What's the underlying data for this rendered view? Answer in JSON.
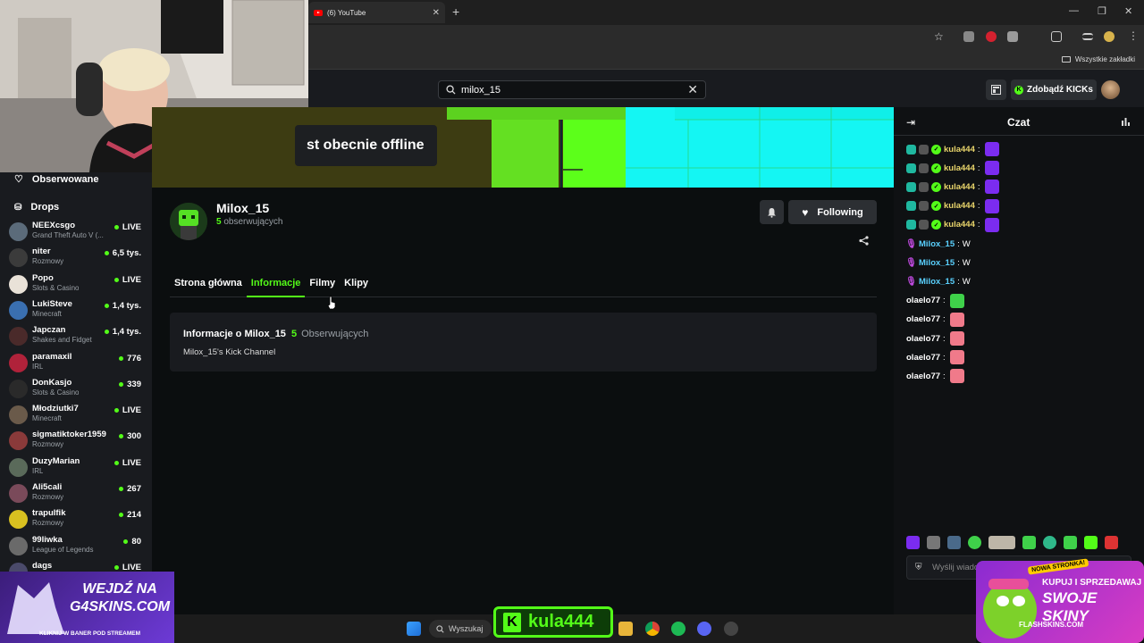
{
  "browser": {
    "tab_title": "(6) YouTube",
    "new_tab": "+",
    "bookmarks_folder": "Wszystkie zakładki"
  },
  "header": {
    "search_value": "milox_15",
    "kicks_button": "Zdobądź KICKs"
  },
  "sidebar": {
    "following": "Obserwowane",
    "drops": "Drops",
    "channels": [
      {
        "name": "NEEXcsgo",
        "category": "Grand Theft Auto V (...",
        "viewers": "LIVE",
        "color": "#5b6b7a"
      },
      {
        "name": "niter",
        "category": "Rozmowy",
        "viewers": "6,5 tys.",
        "color": "#3b3b3b"
      },
      {
        "name": "Popo",
        "category": "Slots & Casino",
        "viewers": "LIVE",
        "color": "#e9e2d8"
      },
      {
        "name": "LukiSteve",
        "category": "Minecraft",
        "viewers": "1,4 tys.",
        "color": "#3a6fb0"
      },
      {
        "name": "Japczan",
        "category": "Shakes and Fidget",
        "viewers": "1,4 tys.",
        "color": "#4a2a2a"
      },
      {
        "name": "paramaxil",
        "category": "IRL",
        "viewers": "776",
        "color": "#b0223a"
      },
      {
        "name": "DonKasjo",
        "category": "Slots & Casino",
        "viewers": "339",
        "color": "#2a2a2a"
      },
      {
        "name": "Młodziutki7",
        "category": "Minecraft",
        "viewers": "LIVE",
        "color": "#6a5a4a"
      },
      {
        "name": "sigmatiktoker1959",
        "category": "Rozmowy",
        "viewers": "300",
        "color": "#8a3a3a"
      },
      {
        "name": "DuzyMarian",
        "category": "IRL",
        "viewers": "LIVE",
        "color": "#5a6a5a"
      },
      {
        "name": "Ali5cali",
        "category": "Rozmowy",
        "viewers": "267",
        "color": "#7a4a5a"
      },
      {
        "name": "trapulfik",
        "category": "Rozmowy",
        "viewers": "214",
        "color": "#d8c020"
      },
      {
        "name": "99liwka",
        "category": "League of Legends",
        "viewers": "80",
        "color": "#6a6a6a"
      },
      {
        "name": "dags",
        "category": "",
        "viewers": "LIVE",
        "color": "#4a4a6a"
      }
    ]
  },
  "banner": {
    "offline_text": "st obecnie offline"
  },
  "profile": {
    "name": "Milox_15",
    "followers_count": "5",
    "followers_label": "obserwujących",
    "following_button": "Following"
  },
  "tabs": [
    "Strona główna",
    "Informacje",
    "Filmy",
    "Klipy"
  ],
  "about": {
    "title": "Informacje o Milox_15",
    "count": "5",
    "count_label": "Obserwujących",
    "description": "Milox_15's Kick Channel"
  },
  "chat": {
    "title": "Czat",
    "messages": [
      {
        "user": "kula444",
        "text": "",
        "user_color": "#e9d56b",
        "badges": true,
        "emote": "#7b2cf0"
      },
      {
        "user": "kula444",
        "text": "",
        "user_color": "#e9d56b",
        "badges": true,
        "emote": "#7b2cf0"
      },
      {
        "user": "kula444",
        "text": "",
        "user_color": "#e9d56b",
        "badges": true,
        "emote": "#7b2cf0"
      },
      {
        "user": "kula444",
        "text": "",
        "user_color": "#e9d56b",
        "badges": true,
        "emote": "#7b2cf0"
      },
      {
        "user": "kula444",
        "text": "",
        "user_color": "#e9d56b",
        "badges": true,
        "emote": "#7b2cf0"
      },
      {
        "user": "Milox_15",
        "text": "W",
        "user_color": "#5ad1ff",
        "badges": false,
        "emote": ""
      },
      {
        "user": "Milox_15",
        "text": "W",
        "user_color": "#5ad1ff",
        "badges": false,
        "emote": ""
      },
      {
        "user": "Milox_15",
        "text": "W",
        "user_color": "#5ad1ff",
        "badges": false,
        "emote": ""
      },
      {
        "user": "olaelo77",
        "text": "",
        "user_color": "#ffffff",
        "badges": false,
        "emote": "#3fd14a"
      },
      {
        "user": "olaelo77",
        "text": "",
        "user_color": "#ffffff",
        "badges": false,
        "emote": "#f07a8a"
      },
      {
        "user": "olaelo77",
        "text": "",
        "user_color": "#ffffff",
        "badges": false,
        "emote": "#f07a8a"
      },
      {
        "user": "olaelo77",
        "text": "",
        "user_color": "#ffffff",
        "badges": false,
        "emote": "#f07a8a"
      },
      {
        "user": "olaelo77",
        "text": "",
        "user_color": "#ffffff",
        "badges": false,
        "emote": "#f07a8a"
      }
    ],
    "input_placeholder": "Wyślij wiadomość"
  },
  "overlays": {
    "left_ad_main": "WEJDŹ NA\nG4SKINS.COM",
    "left_ad_sub": "KLIKNIJ W BANER POD STREAMEM",
    "right_ad_badge": "NOWA STRONKA!",
    "right_ad_line1": "KUPUJ I SPRZEDAWAJ",
    "right_ad_line2": "SWOJE SKINY",
    "right_ad_line3": "FLASHSKINS.COM",
    "kick_name": "kula444"
  },
  "taskbar": {
    "search_label": "Wyszukaj"
  },
  "colors": {
    "accent": "#53fc18",
    "background": "#0b0e0f",
    "panel": "#191b1f"
  }
}
